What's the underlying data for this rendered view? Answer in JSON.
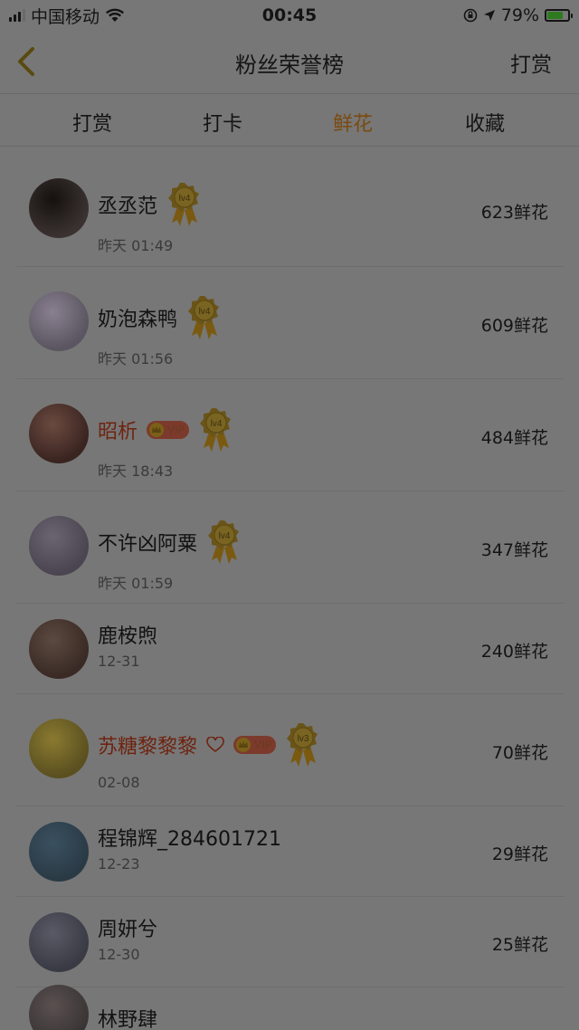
{
  "status_bar": {
    "carrier": "中国移动",
    "time": "00:45",
    "battery_percent": "79%",
    "battery_level": 0.79
  },
  "nav": {
    "title": "粉丝荣誉榜",
    "action_label": "打赏",
    "back_icon": "chevron-left-icon"
  },
  "tabs": [
    "打赏",
    "打卡",
    "鲜花",
    "收藏"
  ],
  "active_tab": "鲜花",
  "colors": {
    "accent": "#7a4a10",
    "vip_name": "#6e2410",
    "overlay_bg": "#777777"
  },
  "fans": [
    {
      "name": "丞丞范",
      "time": "昨天 01:49",
      "count": "623鲜花",
      "medal": "lv4",
      "vip": false
    },
    {
      "name": "奶泡森鸭",
      "time": "昨天 01:56",
      "count": "609鲜花",
      "medal": "lv4",
      "vip": false
    },
    {
      "name": "昭析",
      "time": "昨天 18:43",
      "count": "484鲜花",
      "medal": "lv4",
      "vip": true,
      "vip_label": "VIP"
    },
    {
      "name": "不许凶阿粟",
      "time": "昨天 01:59",
      "count": "347鲜花",
      "medal": "lv4",
      "vip": false
    },
    {
      "name": "鹿桉煦",
      "time": "12-31",
      "count": "240鲜花",
      "medal": "",
      "vip": false
    },
    {
      "name": "苏糖黎黎黎",
      "time": "02-08",
      "count": "70鲜花",
      "medal": "lv3",
      "vip": true,
      "vip_label": "VIP",
      "heart": true
    },
    {
      "name": "程锦辉_284601721",
      "time": "12-23",
      "count": "29鲜花",
      "medal": "",
      "vip": false
    },
    {
      "name": "周妍兮",
      "time": "12-30",
      "count": "25鲜花",
      "medal": "",
      "vip": false
    },
    {
      "name": "林野肆",
      "time": "",
      "count": "",
      "medal": "",
      "vip": false
    }
  ]
}
